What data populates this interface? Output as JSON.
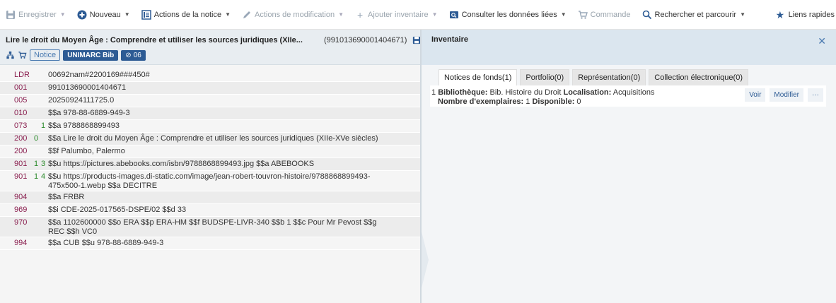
{
  "toolbar": {
    "save": "Enregistrer",
    "new": "Nouveau",
    "record_actions": "Actions de la notice",
    "edit_actions": "Actions de modification",
    "add_inventory": "Ajouter inventaire",
    "view_linked": "Consulter les données liées",
    "order": "Commande",
    "search_browse": "Rechercher et parcourir",
    "quick_links": "Liens rapides"
  },
  "record": {
    "title": "Lire le droit du Moyen Âge : Comprendre et utiliser les sources juridiques (XIIe...",
    "id": "(991013690001404671)",
    "badge_notice": "Notice",
    "badge_format": "UNIMARC Bib",
    "badge_count": "06"
  },
  "marc": [
    {
      "tag": "LDR",
      "i1": "",
      "i2": "",
      "val": "00692nam#2200169###450#"
    },
    {
      "tag": "001",
      "i1": "",
      "i2": "",
      "val": "991013690001404671"
    },
    {
      "tag": "005",
      "i1": "",
      "i2": "",
      "val": "20250924111725.0"
    },
    {
      "tag": "010",
      "i1": "",
      "i2": "",
      "val": "$$a 978-88-6889-949-3"
    },
    {
      "tag": "073",
      "i1": "",
      "i2": "1",
      "val": "$$a 9788868899493"
    },
    {
      "tag": "200",
      "i1": "0",
      "i2": "",
      "val": "$$a Lire le droit du Moyen Âge : Comprendre et utiliser les sources juridiques (XIIe-XVe siècles)"
    },
    {
      "tag": "200",
      "i1": "",
      "i2": "",
      "val": "$$f Palumbo, Palermo"
    },
    {
      "tag": "901",
      "i1": "1",
      "i2": "3",
      "val": "$$u https://pictures.abebooks.com/isbn/9788868899493.jpg $$a ABEBOOKS"
    },
    {
      "tag": "901",
      "i1": "1",
      "i2": "4",
      "val": "$$u https://products-images.di-static.com/image/jean-robert-touvron-histoire/9788868899493-475x500-1.webp $$a DECITRE"
    },
    {
      "tag": "904",
      "i1": "",
      "i2": "",
      "val": "$$a FRBR"
    },
    {
      "tag": "969",
      "i1": "",
      "i2": "",
      "val": "$$i CDE-2025-017565-DSPE/02 $$d 33"
    },
    {
      "tag": "970",
      "i1": "",
      "i2": "",
      "val": "$$a 1102600000 $$o ERA $$p ERA-HM $$f BUDSPE-LIVR-340 $$b 1 $$c Pour Mr Pevost $$g REC $$h VC0"
    },
    {
      "tag": "994",
      "i1": "",
      "i2": "",
      "val": "$$a CUB $$u 978-88-6889-949-3"
    }
  ],
  "inventory": {
    "title": "Inventaire",
    "tabs": [
      "Notices de fonds(1)",
      "Portfolio(0)",
      "Représentation(0)",
      "Collection électronique(0)"
    ],
    "item": {
      "num": "1",
      "lib_label": "Bibliothèque:",
      "lib_value": "Bib. Histoire du Droit",
      "loc_label": "Localisation:",
      "loc_value": "Acquisitions",
      "copies_label": "Nombre d'exemplaires:",
      "copies_value": "1",
      "avail_label": "Disponible:",
      "avail_value": "0"
    },
    "actions": [
      "Voir",
      "Modifier",
      "···"
    ]
  },
  "colors": {
    "tag": "#8a1f4f",
    "indicator": "#2b8a2b",
    "accent": "#2d5b94"
  }
}
